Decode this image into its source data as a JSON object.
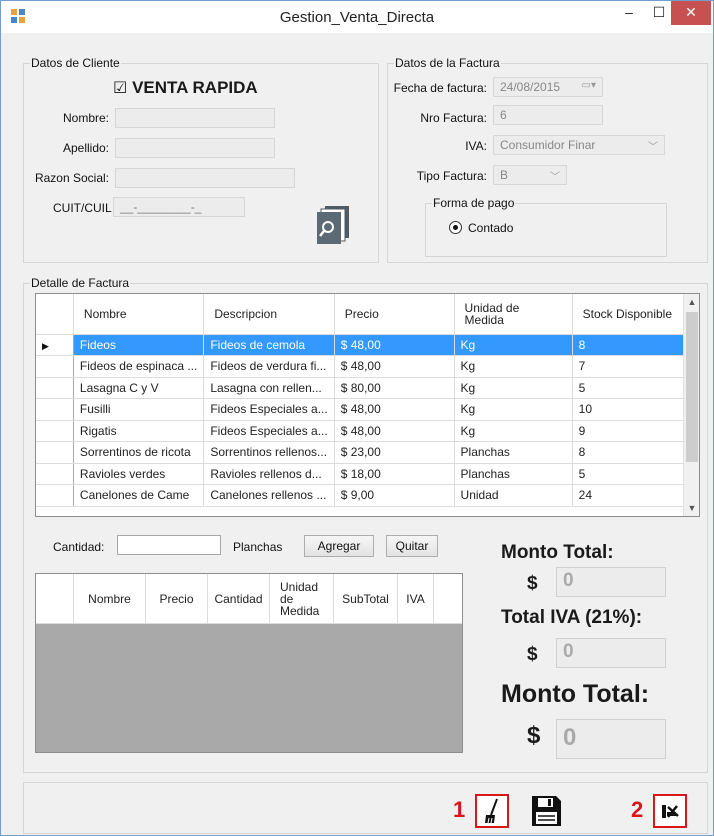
{
  "window": {
    "title": "Gestion_Venta_Directa",
    "minimize": "–",
    "maximize": "☐",
    "close": "✕"
  },
  "cliente": {
    "group_label": "Datos de Cliente",
    "venta_rapida_label": "VENTA RAPIDA",
    "venta_rapida_checked": true,
    "nombre_label": "Nombre:",
    "apellido_label": "Apellido:",
    "razon_label": "Razon Social:",
    "cuit_label": "CUIT/CUIL",
    "nombre_value": "",
    "apellido_value": "",
    "razon_value": "",
    "cuit_value": "__-________-_"
  },
  "factura": {
    "group_label": "Datos de la Factura",
    "fecha_label": "Fecha de factura:",
    "fecha_value": "24/08/2015",
    "nro_label": "Nro Factura:",
    "nro_value": "6",
    "iva_label": "IVA:",
    "iva_value": "Consumidor Finar",
    "tipo_label": "Tipo Factura:",
    "tipo_value": "B",
    "forma_pago_label": "Forma de pago",
    "contado_label": "Contado"
  },
  "detalle": {
    "group_label": "Detalle de Factura",
    "columns": [
      "Nombre",
      "Descripcion",
      "Precio",
      "Unidad de Medida",
      "Stock Disponible"
    ],
    "rows": [
      [
        "Fideos",
        "Fideos de cemola",
        "$ 48,00",
        "Kg",
        "8"
      ],
      [
        "Fideos de espinaca ...",
        "Fideos de verdura fi...",
        "$ 48,00",
        "Kg",
        "7"
      ],
      [
        "Lasagna C y V",
        "Lasagna con rellen...",
        "$ 80,00",
        "Kg",
        "5"
      ],
      [
        "Fusilli",
        "Fideos Especiales a...",
        "$ 48,00",
        "Kg",
        "10"
      ],
      [
        "Rigatis",
        "Fideos Especiales a...",
        "$ 48,00",
        "Kg",
        "9"
      ],
      [
        "Sorrentinos de ricota",
        "Sorrentinos rellenos...",
        "$ 23,00",
        "Planchas",
        "8"
      ],
      [
        "Ravioles verdes",
        "Ravioles rellenos d...",
        "$ 18,00",
        "Planchas",
        "5"
      ],
      [
        "Canelones de Came",
        "Canelones rellenos ...",
        "$ 9,00",
        "Unidad",
        "24"
      ]
    ],
    "selected_row": 0
  },
  "cantidad": {
    "label": "Cantidad:",
    "value": "",
    "unit": "Planchas",
    "agregar": "Agregar",
    "quitar": "Quitar"
  },
  "carrito": {
    "columns": [
      "Nombre",
      "Precio",
      "Cantidad",
      "Unidad de Medida",
      "SubTotal",
      "IVA"
    ]
  },
  "totales": {
    "monto_total_label": "Monto Total:",
    "monto_total_value": "0",
    "total_iva_label": "Total IVA (21%):",
    "total_iva_value": "0",
    "monto_total2_label": "Monto Total:",
    "monto_total2_value": "0",
    "currency": "$"
  },
  "acciones": {
    "marker_1": "1",
    "marker_2": "2"
  },
  "colors": {
    "selection": "#3399ff",
    "marker_red": "#d9161c",
    "close_btn": "#c75050"
  }
}
